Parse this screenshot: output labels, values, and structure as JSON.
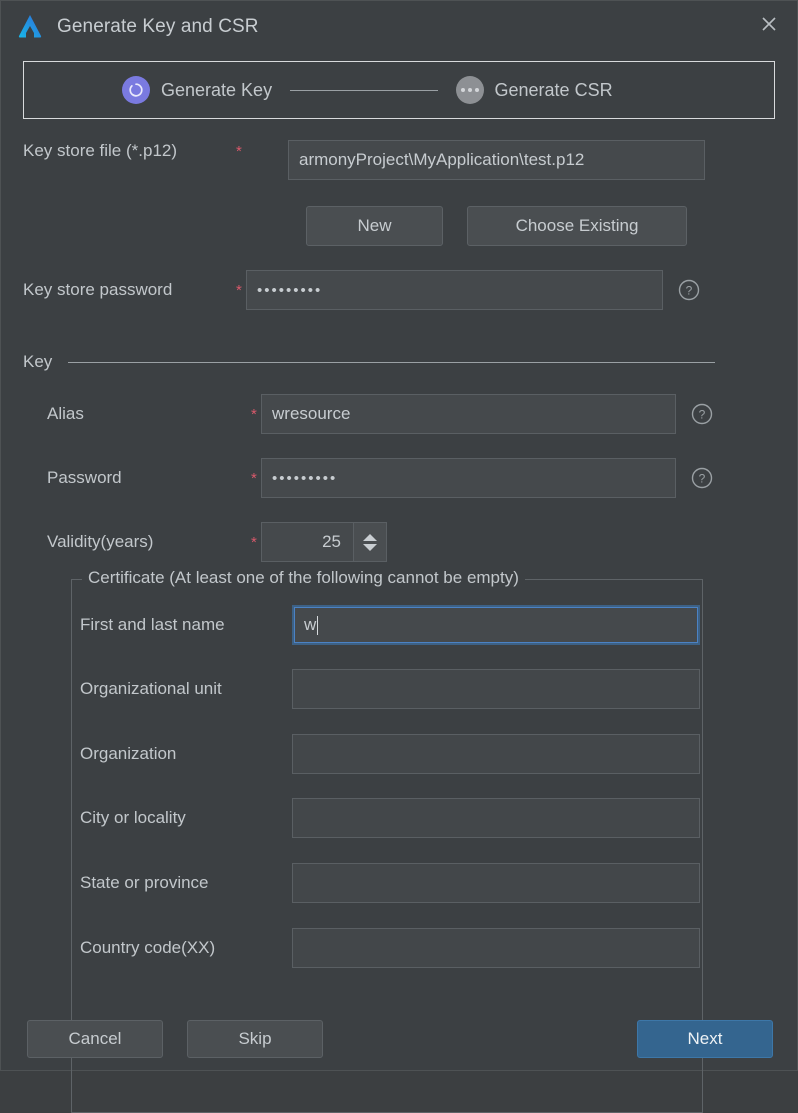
{
  "window": {
    "title": "Generate Key and CSR",
    "logo_icon": "deveco-studio-logo",
    "close_icon": "close-icon"
  },
  "steps": [
    {
      "label": "Generate Key",
      "state": "active",
      "icon": "key-ring-icon"
    },
    {
      "label": "Generate CSR",
      "state": "inactive",
      "icon": "ellipsis-icon"
    }
  ],
  "keystore": {
    "file_label": "Key store file (*.p12)",
    "file_required": "*",
    "file_value": "armonyProject\\MyApplication\\test.p12",
    "new_button": "New",
    "choose_existing_button": "Choose Existing",
    "password_label": "Key store password",
    "password_required": "*",
    "password_value": "•••••••••",
    "password_help_icon": "help-icon"
  },
  "key_section": {
    "title": "Key",
    "alias_label": "Alias",
    "alias_required": "*",
    "alias_value": "wresource",
    "alias_help_icon": "help-icon",
    "password_label": "Password",
    "password_required": "*",
    "password_value": "•••••••••",
    "password_help_icon": "help-icon",
    "validity_label": "Validity(years)",
    "validity_required": "*",
    "validity_value": "25"
  },
  "certificate": {
    "group_title": "Certificate (At least one of the following cannot be empty)",
    "fields": [
      {
        "label": "First and last name",
        "value": "w",
        "focused": true
      },
      {
        "label": "Organizational unit",
        "value": "",
        "focused": false
      },
      {
        "label": "Organization",
        "value": "",
        "focused": false
      },
      {
        "label": "City or locality",
        "value": "",
        "focused": false
      },
      {
        "label": "State or province",
        "value": "",
        "focused": false
      },
      {
        "label": "Country code(XX)",
        "value": "",
        "focused": false
      }
    ]
  },
  "footer": {
    "cancel": "Cancel",
    "skip": "Skip",
    "next": "Next"
  },
  "colors": {
    "background": "#3c4043",
    "field_bg": "#45494c",
    "accent_primary": "#34658f",
    "step_active": "#7a7ae0",
    "step_inactive": "#8d9094",
    "required_star": "#d9596b",
    "focus_border": "#4b82c4"
  }
}
